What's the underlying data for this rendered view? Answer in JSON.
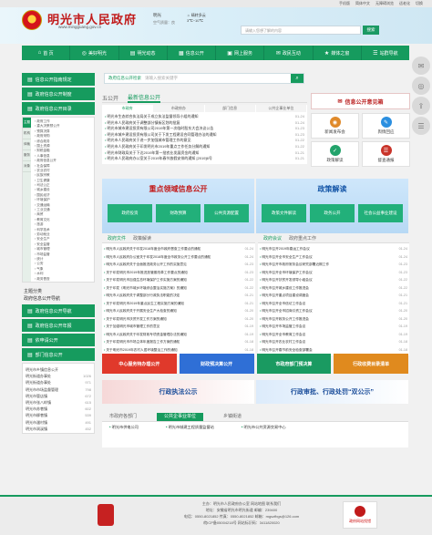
{
  "topbar": {
    "links": [
      "手机版",
      "简体中文",
      "无障碍浏览",
      "适老化",
      "切换"
    ]
  },
  "header": {
    "title": "明光市人民政府",
    "url": "www.mingguang.gov.cn",
    "city": "明光",
    "city_sub": "空气质量：良",
    "weather": "☼ 晴转多云",
    "weather_sub": "3℃~10℃",
    "search_placeholder": "请输入您想了解的内容",
    "search_button": "搜索"
  },
  "nav": [
    {
      "icon": "⌂",
      "label": "首 页"
    },
    {
      "icon": "◎",
      "label": "美好明光"
    },
    {
      "icon": "▤",
      "label": "明光动态"
    },
    {
      "icon": "▦",
      "label": "信息公开"
    },
    {
      "icon": "▣",
      "label": "网上服务"
    },
    {
      "icon": "✉",
      "label": "政民互动"
    },
    {
      "icon": "★",
      "label": "媒体之窗"
    },
    {
      "icon": "☰",
      "label": "站群导航"
    }
  ],
  "sidebar": {
    "buttons": [
      "信息公开指南规定",
      "政府信息公开制度",
      "政府信息公开目录"
    ],
    "tree_tabs": [
      "主题",
      "机构",
      "体裁",
      "服务",
      "对象"
    ],
    "tree_items": [
      "政府工作",
      "重大决策预公开",
      "预算决算",
      "政府采购",
      "综合政务",
      "国土资源",
      "财税金融",
      "人事信息",
      "政府信息公开",
      "社会保障",
      "农业农村",
      "民族宗教",
      "卫生健康",
      "司法公正",
      "城乡建设",
      "国民经济",
      "环境保护",
      "交通运输",
      "工业交通",
      "商贸",
      "教育文化",
      "旅游",
      "科学技术",
      "劳动就业",
      "安全生产",
      "安全监管",
      "城市管理",
      "市场监管",
      "统计",
      "公安",
      "气象",
      "水利",
      "政务督查",
      "民政"
    ],
    "theme_title": "主题分类",
    "theme_title2": "政府信息公开导航",
    "bottom_buttons": [
      "政府信息公开导航",
      "政府信息公开年报",
      "依申请公开",
      "部门信息公开"
    ],
    "list_title": "明光市乡镇信息公开",
    "list": [
      {
        "name": "明光街道办事处",
        "n": "1026"
      },
      {
        "name": "明光街道办事处",
        "n": "971"
      },
      {
        "name": "明光市市场监督管理",
        "n": "798"
      },
      {
        "name": "明光市管店镇",
        "n": "672"
      },
      {
        "name": "明光市张八岭镇",
        "n": "615"
      },
      {
        "name": "明光市苏巷镇",
        "n": "602"
      },
      {
        "name": "明光市柳巷镇",
        "n": "539"
      },
      {
        "name": "明光市潘村镇",
        "n": "491"
      },
      {
        "name": "明光市涧溪镇",
        "n": "452"
      }
    ]
  },
  "main": {
    "gov_search_label": "政府信息公开检索",
    "gov_search_placeholder": "请输入搜索关键字",
    "tabs": [
      "五公开",
      "最新信息公开"
    ],
    "subtabs": [
      "市政府",
      "市政府办",
      "部门信息",
      "公共企事业单位"
    ],
    "news": [
      {
        "t": "明光市生态综合执法局关于成立执法监督领导小组的通知",
        "d": "01-24"
      },
      {
        "t": "明光市人民政府关于调整部分镇街区划的批复",
        "d": "01-24"
      },
      {
        "t": "明光市城市建设投资有限公司2019年第一次临时股东大会决议公告",
        "d": "01-23"
      },
      {
        "t": "明光市城乡建设投资有限公司关于下发工程建设合同管理办法的通知",
        "d": "01-23"
      },
      {
        "t": "明光市人民政府关于进一步加强城市管理工作的意见",
        "d": "01-22"
      },
      {
        "t": "明光市人民政府关于印发明光市2019年重点工作任务分解的通知",
        "d": "01-22"
      },
      {
        "t": "明光市财政局关于下达2019年第一批农业发展资金的通知",
        "d": "01-21"
      },
      {
        "t": "明光市人民政府办公室关于2019年春节放假安排的通知 [2019]6号",
        "d": "01-21"
      }
    ]
  },
  "right_col": {
    "guide": "信息公开意见箱",
    "tiles": [
      {
        "label": "新闻发布会",
        "color": "#e08a2b",
        "icon": "◉"
      },
      {
        "label": "舆情回应",
        "color": "#2b8fe0",
        "icon": "✎"
      },
      {
        "label": "政策解读",
        "color": "#22a36b",
        "icon": "✓"
      },
      {
        "label": "督查通报",
        "color": "#c9342a",
        "icon": "☰"
      }
    ]
  },
  "banners": [
    {
      "head": "重点领域信息公开",
      "style": "red",
      "buttons": [
        "政府投资",
        "财政预算",
        "公共资源配置"
      ]
    },
    {
      "head": "政策解读",
      "style": "blue",
      "buttons": [
        "政策文件解读",
        "政务公开",
        "社会公益事业建设"
      ]
    }
  ],
  "lower_left": {
    "tabs": [
      "政府文件",
      "政策解读"
    ],
    "rows": [
      {
        "t": "明光市人民政府关于印发2018年度全市政府督查工作要点的通知",
        "d": "01-24"
      },
      {
        "t": "明光市人民政府办公室关于印发2018年度全市政务公开工作要点的通知",
        "d": "01-24"
      },
      {
        "t": "明光市人民政府关于全面推进政务公开工作的实施意见",
        "d": "01-23"
      },
      {
        "t": "关于印发明光市2019年推进放管服改革工作要点的通知",
        "d": "01-23"
      },
      {
        "t": "关于印发明光市加强生态环境保护工作实施方案的通知",
        "d": "01-22"
      },
      {
        "t": "关于印发《明光市城乡环境综合整治实施方案》的通知",
        "d": "01-22"
      },
      {
        "t": "明光市人民政府关于调整部分行政执法职能的决定",
        "d": "01-21"
      },
      {
        "t": "关于印发明光市2019年重点民生工程实施方案的通知",
        "d": "01-21"
      },
      {
        "t": "明光市人民政府关于开展安全生产大检查的通知",
        "d": "01-20"
      },
      {
        "t": "关于印发明光市扶贫开发工作方案的通知",
        "d": "01-20"
      },
      {
        "t": "关于加强明光市城市管理工作的意见",
        "d": "01-19"
      },
      {
        "t": "明光市人民政府关于印发财政专项资金管理办法的通知",
        "d": "01-19"
      },
      {
        "t": "关于印发明光市市场主体年度报告工作方案的通知",
        "d": "01-18"
      },
      {
        "t": "关于明光市2019年农村人居环境整治工作的通知",
        "d": "01-18"
      }
    ]
  },
  "lower_right": {
    "tabs": [
      "政府会议",
      "政府重点工作"
    ],
    "rows": [
      {
        "t": "明光市召开2019年春运工作会议",
        "d": "01-24"
      },
      {
        "t": "明光市召开全市安全生产工作会议",
        "d": "01-24"
      },
      {
        "t": "明光市召开市政府常务会议研究部署近期工作",
        "d": "01-23"
      },
      {
        "t": "明光市召开全市环境保护工作会议",
        "d": "01-23"
      },
      {
        "t": "明光市召开扶贫开发领导小组会议",
        "d": "01-22"
      },
      {
        "t": "明光市召开城乡建设工作推进会",
        "d": "01-22"
      },
      {
        "t": "明光市召开重点项目建设调度会",
        "d": "01-21"
      },
      {
        "t": "明光市召开全市信访工作会议",
        "d": "01-21"
      },
      {
        "t": "明光市召开全市招商引资工作会议",
        "d": "01-20"
      },
      {
        "t": "明光市召开政务公开工作推进会",
        "d": "01-20"
      },
      {
        "t": "明光市召开市场监管工作会议",
        "d": "01-19"
      },
      {
        "t": "明光市召开全市教育工作会议",
        "d": "01-19"
      },
      {
        "t": "明光市召开农业农村工作会议",
        "d": "01-18"
      },
      {
        "t": "明光市召开春节前安全检查部署会",
        "d": "01-18"
      }
    ]
  },
  "colorbar": [
    {
      "label": "中心服务特办理公开",
      "color": "#e0392b"
    },
    {
      "label": "财政预决算公开",
      "color": "#2f6fd6"
    },
    {
      "label": "市政府部门预决算",
      "color": "#1a9a61"
    },
    {
      "label": "行政收费目录清单",
      "color": "#e08a1e"
    }
  ],
  "promo": [
    "行政执法公示",
    "行政审批、行政处罚“双公示”"
  ],
  "dept": {
    "tabs": [
      "市政府各部门",
      "公共企事业单位",
      "乡镇街道"
    ],
    "items": [
      "明光市供电公司",
      "明光市城建工程质量监督站",
      "明光市公共资源交易中心"
    ]
  },
  "footer": {
    "lines": [
      "主办：明光市人民政府办公室  网站地图  联系我们",
      "地址：安徽省明光市明光街道  邮编：239400",
      "电话：0550-8021852  传真：0550-8021852  邮箱：mgszfbgs@126.com",
      "皖ICP备05004218号  网站标识码：3411820020"
    ],
    "logo_text": "政府网站找错"
  }
}
